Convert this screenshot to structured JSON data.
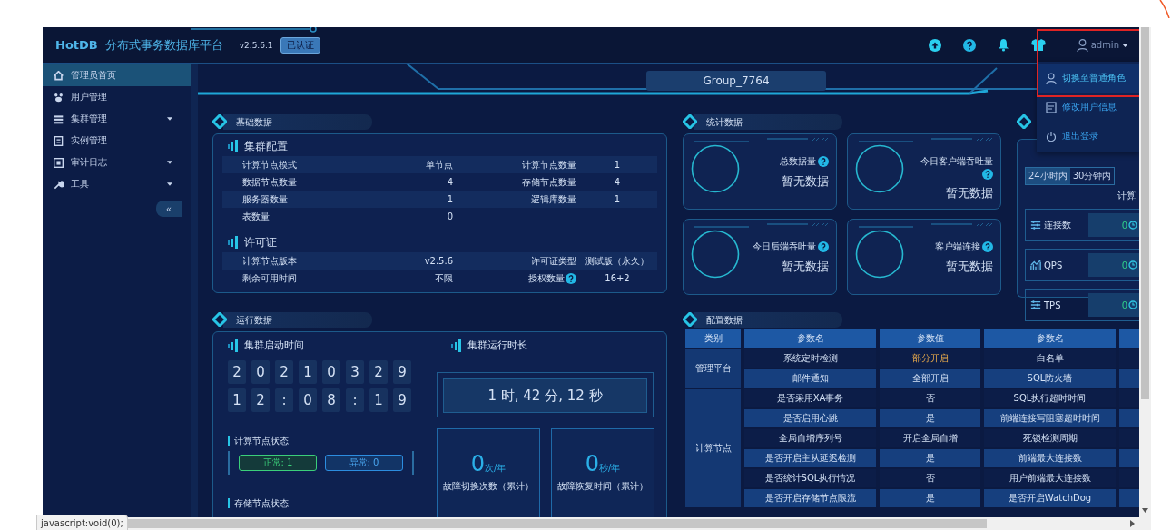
{
  "header": {
    "logo": "HotDB",
    "title": "分布式事务数据库平台",
    "version": "v2.5.6.1",
    "badge": "已认证",
    "user": "admin"
  },
  "user_menu": [
    {
      "label": "切换至普通角色",
      "selected": true
    },
    {
      "label": "修改用户信息",
      "selected": false
    },
    {
      "label": "退出登录",
      "selected": false
    }
  ],
  "sidebar": {
    "items": [
      {
        "label": "管理员首页",
        "selected": true,
        "expandable": false
      },
      {
        "label": "用户管理",
        "selected": false,
        "expandable": false
      },
      {
        "label": "集群管理",
        "selected": false,
        "expandable": true
      },
      {
        "label": "实例管理",
        "selected": false,
        "expandable": false
      },
      {
        "label": "审计日志",
        "selected": false,
        "expandable": true
      },
      {
        "label": "工具",
        "selected": false,
        "expandable": true
      }
    ],
    "collapse": "«"
  },
  "group": "Group_7764",
  "basic": {
    "title": "基础数据",
    "cluster": {
      "title": "集群配置",
      "rows": [
        [
          "计算节点模式",
          "单节点",
          "计算节点数量",
          "1"
        ],
        [
          "数据节点数量",
          "4",
          "存储节点数量",
          "4"
        ],
        [
          "服务器数量",
          "1",
          "逻辑库数量",
          "1"
        ],
        [
          "表数量",
          "0"
        ]
      ]
    },
    "license": {
      "title": "许可证",
      "rows": [
        [
          "计算节点版本",
          "v2.5.6",
          "许可证类型",
          "测试版（永久）"
        ],
        [
          "剩余可用时间",
          "不限",
          "授权数量",
          "16+2"
        ]
      ]
    }
  },
  "stats": {
    "title": "统计数据",
    "cards": [
      {
        "label": "总数据量",
        "value": "暂无数据"
      },
      {
        "label": "今日客户端吞吐量",
        "value": "暂无数据"
      },
      {
        "label": "今日后端吞吐量",
        "value": "暂无数据"
      },
      {
        "label": "客户端连接",
        "value": "暂无数据"
      }
    ]
  },
  "realtime": {
    "tabs": [
      {
        "label": "24小时内",
        "selected": true
      },
      {
        "label": "30分钟内",
        "selected": false
      }
    ],
    "heading": "计算",
    "metrics": [
      {
        "label": "连接数",
        "value": "0"
      },
      {
        "label": "QPS",
        "value": "0"
      },
      {
        "label": "TPS",
        "value": "0"
      }
    ]
  },
  "runtime": {
    "title": "运行数据",
    "start": {
      "title": "集群启动时间",
      "date": [
        "2",
        "0",
        "2",
        "1",
        "0",
        "3",
        "2",
        "9"
      ],
      "time": [
        "1",
        "2",
        ":",
        "0",
        "8",
        ":",
        "1",
        "9"
      ]
    },
    "uptime": {
      "title": "集群运行时长",
      "value": "1 时, 42 分, 12 秒"
    },
    "faults": [
      {
        "value": "0",
        "unit": "次/年",
        "label": "故障切换次数（累计）"
      },
      {
        "value": "0",
        "unit": "秒/年",
        "label": "故障恢复时间（累计）"
      }
    ],
    "compute_status": {
      "title": "计算节点状态",
      "counts": [
        {
          "label": "正常: 1",
          "kind": "normal"
        },
        {
          "label": "异常: 0",
          "kind": "abnormal"
        }
      ]
    },
    "storage_status": {
      "title": "存储节点状态"
    }
  },
  "config": {
    "title": "配置数据",
    "columns": [
      "类别",
      "参数名",
      "参数值",
      "参数名"
    ],
    "groups": [
      {
        "category": "管理平台",
        "rows": [
          {
            "name": "系统定时检测",
            "value": "部分开启",
            "name_2": "白名单",
            "warning": true
          },
          {
            "name": "邮件通知",
            "value": "全部开启",
            "name_2": "SQL防火墙",
            "warning": false
          }
        ]
      },
      {
        "category": "计算节点",
        "rows": [
          {
            "name": "是否采用XA事务",
            "value": "否",
            "name_2": "SQL执行超时时间",
            "warning": false
          },
          {
            "name": "是否启用心跳",
            "value": "是",
            "name_2": "前端连接写阻塞超时时间",
            "warning": false
          },
          {
            "name": "全局自增序列号",
            "value": "开启全局自增",
            "name_2": "死锁检测周期",
            "warning": false
          },
          {
            "name": "是否开启主从延迟检测",
            "value": "是",
            "name_2": "前端最大连接数",
            "warning": false
          },
          {
            "name": "是否统计SQL执行情况",
            "value": "否",
            "name_2": "用户前端最大连接数",
            "warning": false
          },
          {
            "name": "是否开启存储节点限流",
            "value": "是",
            "name_2": "是否开启WatchDog",
            "warning": false
          }
        ]
      }
    ]
  },
  "status_bar": "javascript:void(0);"
}
